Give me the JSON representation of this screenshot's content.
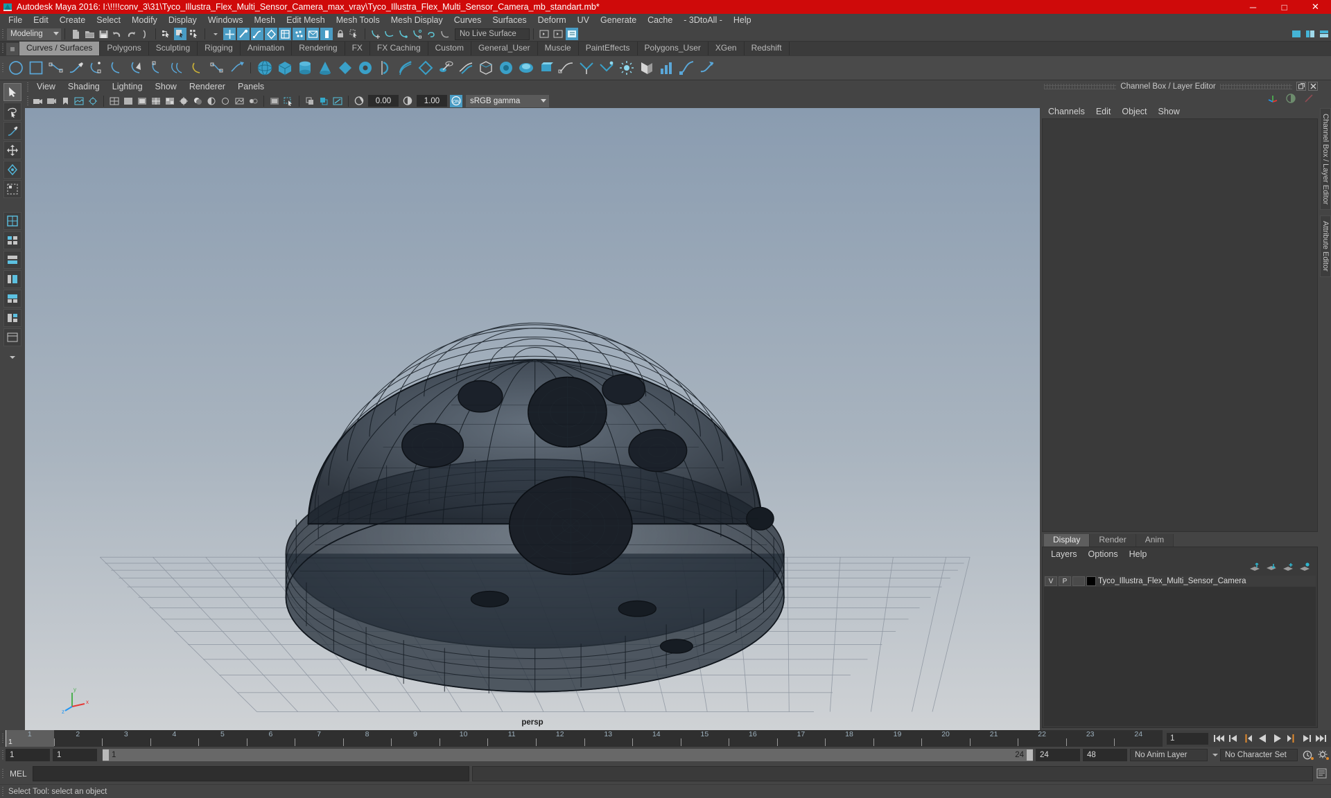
{
  "window": {
    "title": "Autodesk Maya 2016: I:\\!!!!conv_3\\31\\Tyco_Illustra_Flex_Multi_Sensor_Camera_max_vray\\Tyco_Illustra_Flex_Multi_Sensor_Camera_mb_standart.mb*",
    "minimize": "─",
    "maximize": "□",
    "close": "✕",
    "titlebar_color": "#cf0a0a"
  },
  "menubar": {
    "items": [
      {
        "label": "File"
      },
      {
        "label": "Edit"
      },
      {
        "label": "Create"
      },
      {
        "label": "Select"
      },
      {
        "label": "Modify"
      },
      {
        "label": "Display"
      },
      {
        "label": "Windows"
      },
      {
        "label": "Mesh"
      },
      {
        "label": "Edit Mesh"
      },
      {
        "label": "Mesh Tools"
      },
      {
        "label": "Mesh Display"
      },
      {
        "label": "Curves"
      },
      {
        "label": "Surfaces"
      },
      {
        "label": "Deform"
      },
      {
        "label": "UV"
      },
      {
        "label": "Generate"
      },
      {
        "label": "Cache"
      },
      {
        "label": "- 3DtoAll -"
      },
      {
        "label": "Help"
      }
    ]
  },
  "statusline": {
    "mode": "Modeling",
    "live_surface": "No Live Surface"
  },
  "shelf": {
    "tabs": [
      {
        "label": "Curves / Surfaces",
        "active": true
      },
      {
        "label": "Polygons",
        "active": false
      },
      {
        "label": "Sculpting",
        "active": false
      },
      {
        "label": "Rigging",
        "active": false
      },
      {
        "label": "Animation",
        "active": false
      },
      {
        "label": "Rendering",
        "active": false
      },
      {
        "label": "FX",
        "active": false
      },
      {
        "label": "FX Caching",
        "active": false
      },
      {
        "label": "Custom",
        "active": false
      },
      {
        "label": "General_User",
        "active": false
      },
      {
        "label": "Muscle",
        "active": false
      },
      {
        "label": "PaintEffects",
        "active": false
      },
      {
        "label": "Polygons_User",
        "active": false
      },
      {
        "label": "XGen",
        "active": false
      },
      {
        "label": "Redshift",
        "active": false
      }
    ]
  },
  "viewport": {
    "menu": [
      {
        "label": "View"
      },
      {
        "label": "Shading"
      },
      {
        "label": "Lighting"
      },
      {
        "label": "Show"
      },
      {
        "label": "Renderer"
      },
      {
        "label": "Panels"
      }
    ],
    "exposure_value": "0.00",
    "gamma_value": "1.00",
    "color_management": "sRGB gamma",
    "camera_label": "persp",
    "gradient_top": "#8a9cb0",
    "gradient_bottom": "#c9cdd2"
  },
  "channelbox": {
    "panel_title": "Channel Box / Layer Editor",
    "menu": [
      {
        "label": "Channels"
      },
      {
        "label": "Edit"
      },
      {
        "label": "Object"
      },
      {
        "label": "Show"
      }
    ]
  },
  "layereditor": {
    "tabs": [
      {
        "label": "Display",
        "active": true
      },
      {
        "label": "Render",
        "active": false
      },
      {
        "label": "Anim",
        "active": false
      }
    ],
    "menu": [
      {
        "label": "Layers"
      },
      {
        "label": "Options"
      },
      {
        "label": "Help"
      }
    ],
    "columns": {
      "visibility": "V",
      "playback": "P"
    },
    "layers": [
      {
        "v": "V",
        "p": "P",
        "state": "",
        "color": "#000000",
        "name": "Tyco_Illustra_Flex_Multi_Sensor_Camera"
      }
    ]
  },
  "sidetabs": [
    {
      "label": "Channel Box / Layer Editor"
    },
    {
      "label": "Attribute Editor"
    }
  ],
  "timeline": {
    "ticks": [
      "1",
      "2",
      "3",
      "4",
      "5",
      "6",
      "7",
      "8",
      "9",
      "10",
      "11",
      "12",
      "13",
      "14",
      "15",
      "16",
      "17",
      "18",
      "19",
      "20",
      "21",
      "22",
      "23",
      "24"
    ],
    "current_frame": "1",
    "current_frame_field": "1",
    "range_start": "1",
    "range_end": "1",
    "slider_min": "1",
    "slider_max": "24",
    "anim_start": "24",
    "anim_end": "48",
    "anim_layer": "No Anim Layer",
    "character_set": "No Character Set"
  },
  "command": {
    "language": "MEL",
    "input_value": "",
    "output_value": ""
  },
  "status": {
    "help_text": "Select Tool: select an object"
  }
}
